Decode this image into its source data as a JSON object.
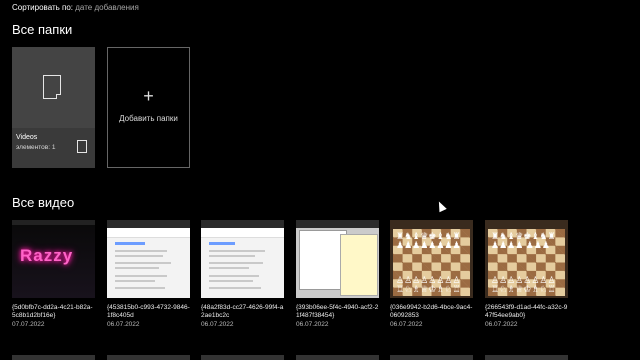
{
  "sort": {
    "label": "Сортировать по:",
    "value": "дате добавления"
  },
  "folders": {
    "title": "Все папки",
    "items": [
      {
        "name": "Videos",
        "count": "элементов: 1"
      }
    ],
    "add_label": "Добавить папки",
    "add_icon": "plus-icon"
  },
  "videos": {
    "title": "Все видео",
    "items": [
      {
        "name": "{5d0bfb7c-dd2a-4c21-b82a-5c8b1d2bf16e}",
        "date": "07.07.2022",
        "thumb": "neon-text"
      },
      {
        "name": "{453815b0-c993-4732-9846-1f8c405d",
        "date": "06.07.2022",
        "thumb": "document-page"
      },
      {
        "name": "{48a2f83d-cc27-4626-99f4-a2ae1bc2c",
        "date": "06.07.2022",
        "thumb": "document-page"
      },
      {
        "name": "{393b06ee-5f4c-4940-acf2-21f487f38454}",
        "date": "06.07.2022",
        "thumb": "windows-screenshot"
      },
      {
        "name": "{036e9942-b2d6-4bce-9ac4-06092853",
        "date": "06.07.2022",
        "thumb": "chess-board"
      },
      {
        "name": "{266543f9-d1ad-44fc-a32c-947f54ee9ab0}",
        "date": "06.07.2022",
        "thumb": "chess-board"
      }
    ]
  },
  "colors": {
    "background": "#000000",
    "tile": "#444444",
    "secondary_text": "#a6a6a6",
    "neon": "#ff63c8"
  }
}
